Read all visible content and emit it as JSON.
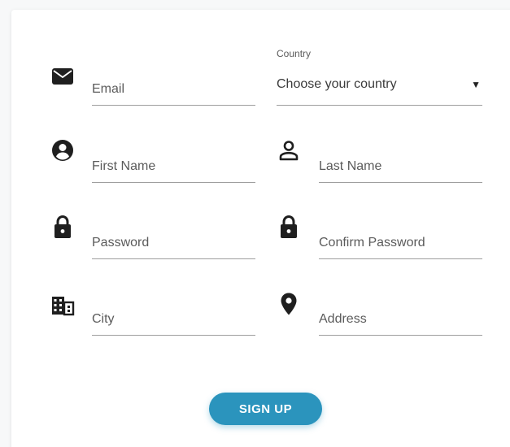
{
  "form": {
    "email_placeholder": "Email",
    "country_label": "Country",
    "country_value": "Choose your country",
    "first_name_placeholder": "First Name",
    "last_name_placeholder": "Last Name",
    "password_placeholder": "Password",
    "confirm_password_placeholder": "Confirm Password",
    "city_placeholder": "City",
    "address_placeholder": "Address",
    "submit_label": "SIGN UP"
  },
  "icons": {
    "email": "envelope-icon",
    "first_name": "account-circle-icon",
    "last_name": "person-outline-icon",
    "password": "lock-icon",
    "confirm_password": "lock-icon",
    "city": "building-icon",
    "address": "location-pin-icon",
    "caret": "dropdown-caret-icon"
  },
  "colors": {
    "accent": "#2b94bd",
    "icon": "#1f1f1f",
    "underline": "#9e9e9e",
    "text_muted": "#5b5b5b"
  }
}
